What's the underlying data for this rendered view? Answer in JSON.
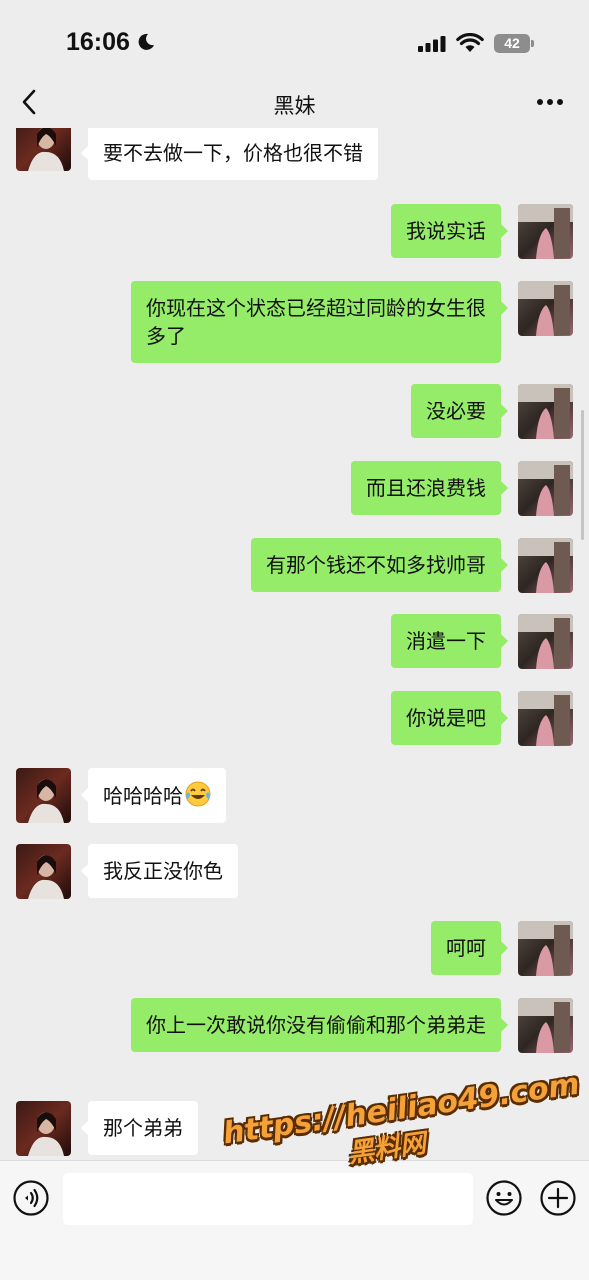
{
  "status_bar": {
    "time": "16:06",
    "battery": "42"
  },
  "header": {
    "title": "黑妹"
  },
  "messages": [
    {
      "from": "them",
      "text": "要不去做一下，价格也很不错"
    },
    {
      "from": "me",
      "text": "我说实话"
    },
    {
      "from": "me",
      "text": "你现在这个状态已经超过同龄的女生很多了"
    },
    {
      "from": "me",
      "text": "没必要"
    },
    {
      "from": "me",
      "text": "而且还浪费钱"
    },
    {
      "from": "me",
      "text": "有那个钱还不如多找帅哥"
    },
    {
      "from": "me",
      "text": "消遣一下"
    },
    {
      "from": "me",
      "text": "你说是吧"
    },
    {
      "from": "them",
      "text": "哈哈哈哈",
      "emoji": "tears-of-joy-emoji"
    },
    {
      "from": "them",
      "text": "我反正没你色"
    },
    {
      "from": "me",
      "text": "呵呵"
    },
    {
      "from": "me",
      "text": "你上一次敢说你没有偷偷和那个弟弟走"
    },
    {
      "from": "them",
      "text": "那个弟弟"
    }
  ],
  "watermark": {
    "url": "https://heiliao49.com",
    "name": "黑料网"
  },
  "input_bar": {
    "voice_icon": "voice-icon",
    "emoji_icon": "emoji-icon",
    "add_icon": "plus-icon"
  },
  "colors": {
    "background": "#ededed",
    "outgoing_bubble": "#95ec69",
    "incoming_bubble": "#ffffff"
  }
}
